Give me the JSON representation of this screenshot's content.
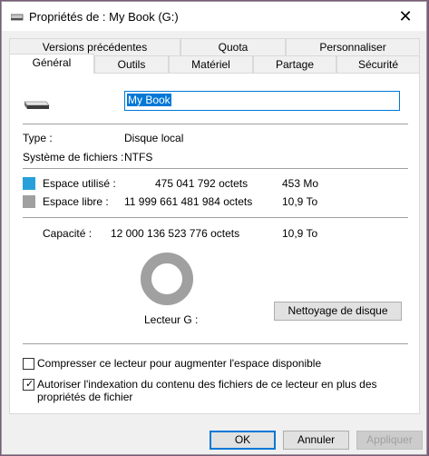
{
  "window": {
    "title": "Propriétés de : My Book (G:)",
    "close_glyph": "✕"
  },
  "tabs_row1": [
    "Versions précédentes",
    "Quota",
    "Personnaliser"
  ],
  "tabs_row2": [
    "Général",
    "Outils",
    "Matériel",
    "Partage",
    "Sécurité"
  ],
  "active_tab": "Général",
  "general": {
    "drive_name": "My Book",
    "type_label": "Type :",
    "type_value": "Disque local",
    "fs_label": "Système de fichiers :",
    "fs_value": "NTFS",
    "used": {
      "label": "Espace utilisé :",
      "bytes": "475 041 792 octets",
      "size": "453 Mo",
      "color": "#26a0da"
    },
    "free": {
      "label": "Espace libre :",
      "bytes": "11 999 661 481 984 octets",
      "size": "10,9 To",
      "color": "#a0a0a0"
    },
    "capacity": {
      "label": "Capacité :",
      "bytes": "12 000 136 523 776 octets",
      "size": "10,9 To"
    },
    "used_fraction": 4e-05,
    "drive_label": "Lecteur G :",
    "cleanup_button": "Nettoyage de disque",
    "compress_label": "Compresser ce lecteur pour augmenter l'espace disponible",
    "compress_checked": false,
    "index_label": "Autoriser l'indexation du contenu des fichiers de ce lecteur en plus des propriétés de fichier",
    "index_checked": true
  },
  "buttons": {
    "ok": "OK",
    "cancel": "Annuler",
    "apply": "Appliquer"
  }
}
